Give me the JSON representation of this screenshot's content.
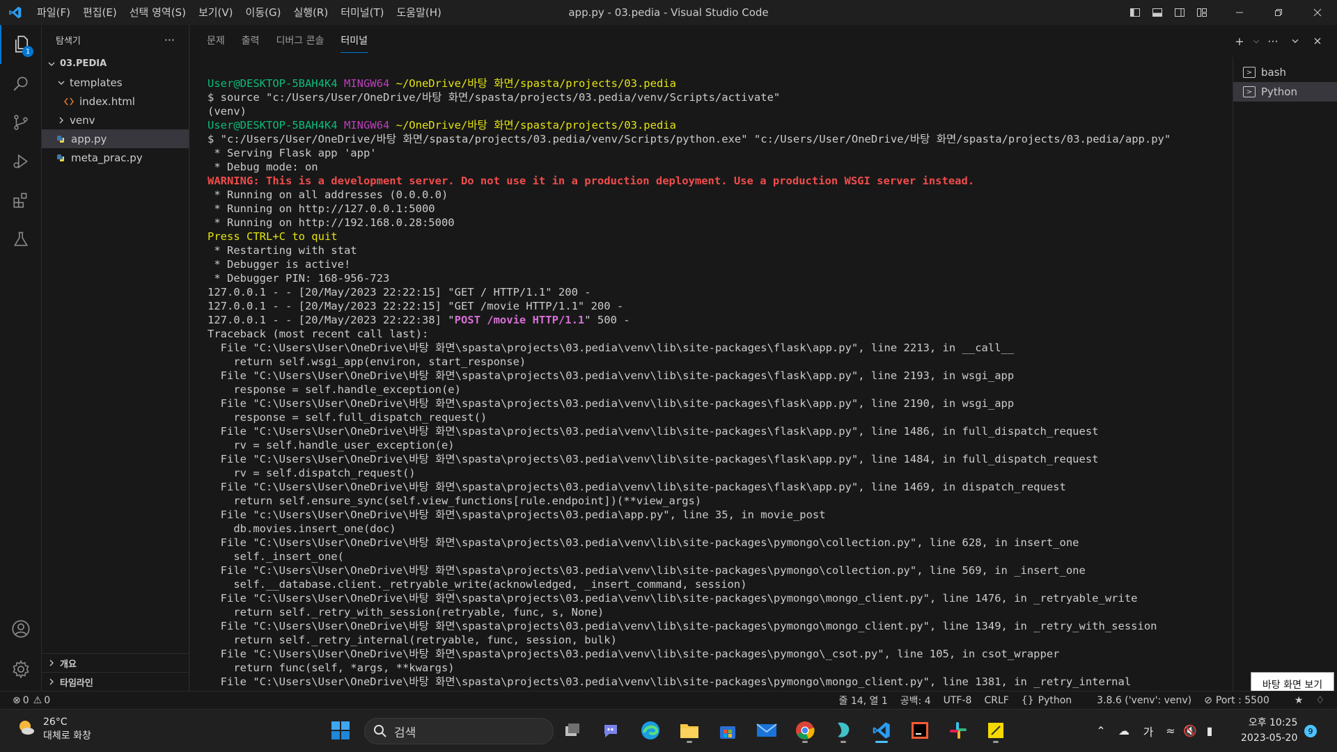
{
  "window": {
    "title": "app.py - 03.pedia - Visual Studio Code",
    "menu": [
      "파일(F)",
      "편집(E)",
      "선택 영역(S)",
      "보기(V)",
      "이동(G)",
      "실행(R)",
      "터미널(T)",
      "도움말(H)"
    ]
  },
  "activity": {
    "explorer_badge": "1"
  },
  "sidebar": {
    "title": "탐색기",
    "more": "···",
    "root": "03.PEDIA",
    "items": [
      {
        "label": "templates",
        "kind": "folder-open"
      },
      {
        "label": "index.html",
        "kind": "html"
      },
      {
        "label": "venv",
        "kind": "folder"
      },
      {
        "label": "app.py",
        "kind": "python"
      },
      {
        "label": "meta_prac.py",
        "kind": "python"
      }
    ],
    "outline": "개요",
    "timeline": "타임라인"
  },
  "panel": {
    "tabs": [
      "문제",
      "출력",
      "디버그 콘솔",
      "터미널"
    ],
    "active_tab": "터미널"
  },
  "terminal": {
    "lines": [
      [
        {
          "t": "User@DESKTOP-5BAH4K4 ",
          "c": "green"
        },
        {
          "t": "MINGW64 ",
          "c": "mag"
        },
        {
          "t": "~/OneDrive/바탕 화면/spasta/projects/03.pedia",
          "c": "yel"
        }
      ],
      [
        {
          "t": "$ source \"c:/Users/User/OneDrive/바탕 화면/spasta/projects/03.pedia/venv/Scripts/activate\"",
          "c": ""
        }
      ],
      [
        {
          "t": "(venv)",
          "c": ""
        }
      ],
      [
        {
          "t": "User@DESKTOP-5BAH4K4 ",
          "c": "green"
        },
        {
          "t": "MINGW64 ",
          "c": "mag"
        },
        {
          "t": "~/OneDrive/바탕 화면/spasta/projects/03.pedia",
          "c": "yel"
        }
      ],
      [
        {
          "t": "$ \"c:/Users/User/OneDrive/바탕 화면/spasta/projects/03.pedia/venv/Scripts/python.exe\" \"c:/Users/User/OneDrive/바탕 화면/spasta/projects/03.pedia/app.py\"",
          "c": ""
        }
      ],
      [
        {
          "t": " * Serving Flask app 'app'",
          "c": ""
        }
      ],
      [
        {
          "t": " * Debug mode: on",
          "c": ""
        }
      ],
      [
        {
          "t": "WARNING: This is a development server. Do not use it in a production deployment. Use a production WSGI server instead.",
          "c": "red"
        }
      ],
      [
        {
          "t": " * Running on all addresses (0.0.0.0)",
          "c": ""
        }
      ],
      [
        {
          "t": " * Running on http://127.0.0.1:5000",
          "c": ""
        }
      ],
      [
        {
          "t": " * Running on http://192.168.0.28:5000",
          "c": ""
        }
      ],
      [
        {
          "t": "Press CTRL+C to quit",
          "c": "yel"
        }
      ],
      [
        {
          "t": " * Restarting with stat",
          "c": ""
        }
      ],
      [
        {
          "t": " * Debugger is active!",
          "c": ""
        }
      ],
      [
        {
          "t": " * Debugger PIN: 168-956-723",
          "c": ""
        }
      ],
      [
        {
          "t": "127.0.0.1 - - [20/May/2023 22:22:15] \"GET / HTTP/1.1\" 200 -",
          "c": ""
        }
      ],
      [
        {
          "t": "127.0.0.1 - - [20/May/2023 22:22:15] \"GET /movie HTTP/1.1\" 200 -",
          "c": ""
        }
      ],
      [
        {
          "t": "127.0.0.1 - - [20/May/2023 22:22:38] \"",
          "c": ""
        },
        {
          "t": "POST /movie HTTP/1.1",
          "c": "pink"
        },
        {
          "t": "\" 500 -",
          "c": ""
        }
      ],
      [
        {
          "t": "Traceback (most recent call last):",
          "c": ""
        }
      ],
      [
        {
          "t": "  File \"C:\\Users\\User\\OneDrive\\바탕 화면\\spasta\\projects\\03.pedia\\venv\\lib\\site-packages\\flask\\app.py\", line 2213, in __call__",
          "c": ""
        }
      ],
      [
        {
          "t": "    return self.wsgi_app(environ, start_response)",
          "c": ""
        }
      ],
      [
        {
          "t": "  File \"C:\\Users\\User\\OneDrive\\바탕 화면\\spasta\\projects\\03.pedia\\venv\\lib\\site-packages\\flask\\app.py\", line 2193, in wsgi_app",
          "c": ""
        }
      ],
      [
        {
          "t": "    response = self.handle_exception(e)",
          "c": ""
        }
      ],
      [
        {
          "t": "  File \"C:\\Users\\User\\OneDrive\\바탕 화면\\spasta\\projects\\03.pedia\\venv\\lib\\site-packages\\flask\\app.py\", line 2190, in wsgi_app",
          "c": ""
        }
      ],
      [
        {
          "t": "    response = self.full_dispatch_request()",
          "c": ""
        }
      ],
      [
        {
          "t": "  File \"C:\\Users\\User\\OneDrive\\바탕 화면\\spasta\\projects\\03.pedia\\venv\\lib\\site-packages\\flask\\app.py\", line 1486, in full_dispatch_request",
          "c": ""
        }
      ],
      [
        {
          "t": "    rv = self.handle_user_exception(e)",
          "c": ""
        }
      ],
      [
        {
          "t": "  File \"C:\\Users\\User\\OneDrive\\바탕 화면\\spasta\\projects\\03.pedia\\venv\\lib\\site-packages\\flask\\app.py\", line 1484, in full_dispatch_request",
          "c": ""
        }
      ],
      [
        {
          "t": "    rv = self.dispatch_request()",
          "c": ""
        }
      ],
      [
        {
          "t": "  File \"C:\\Users\\User\\OneDrive\\바탕 화면\\spasta\\projects\\03.pedia\\venv\\lib\\site-packages\\flask\\app.py\", line 1469, in dispatch_request",
          "c": ""
        }
      ],
      [
        {
          "t": "    return self.ensure_sync(self.view_functions[rule.endpoint])(**view_args)",
          "c": ""
        }
      ],
      [
        {
          "t": "  File \"c:\\Users\\User\\OneDrive\\바탕 화면\\spasta\\projects\\03.pedia\\app.py\", line 35, in movie_post",
          "c": ""
        }
      ],
      [
        {
          "t": "    db.movies.insert_one(doc)",
          "c": ""
        }
      ],
      [
        {
          "t": "  File \"C:\\Users\\User\\OneDrive\\바탕 화면\\spasta\\projects\\03.pedia\\venv\\lib\\site-packages\\pymongo\\collection.py\", line 628, in insert_one",
          "c": ""
        }
      ],
      [
        {
          "t": "    self._insert_one(",
          "c": ""
        }
      ],
      [
        {
          "t": "  File \"C:\\Users\\User\\OneDrive\\바탕 화면\\spasta\\projects\\03.pedia\\venv\\lib\\site-packages\\pymongo\\collection.py\", line 569, in _insert_one",
          "c": ""
        }
      ],
      [
        {
          "t": "    self.__database.client._retryable_write(acknowledged, _insert_command, session)",
          "c": ""
        }
      ],
      [
        {
          "t": "  File \"C:\\Users\\User\\OneDrive\\바탕 화면\\spasta\\projects\\03.pedia\\venv\\lib\\site-packages\\pymongo\\mongo_client.py\", line 1476, in _retryable_write",
          "c": ""
        }
      ],
      [
        {
          "t": "    return self._retry_with_session(retryable, func, s, None)",
          "c": ""
        }
      ],
      [
        {
          "t": "  File \"C:\\Users\\User\\OneDrive\\바탕 화면\\spasta\\projects\\03.pedia\\venv\\lib\\site-packages\\pymongo\\mongo_client.py\", line 1349, in _retry_with_session",
          "c": ""
        }
      ],
      [
        {
          "t": "    return self._retry_internal(retryable, func, session, bulk)",
          "c": ""
        }
      ],
      [
        {
          "t": "  File \"C:\\Users\\User\\OneDrive\\바탕 화면\\spasta\\projects\\03.pedia\\venv\\lib\\site-packages\\pymongo\\_csot.py\", line 105, in csot_wrapper",
          "c": ""
        }
      ],
      [
        {
          "t": "    return func(self, *args, **kwargs)",
          "c": ""
        }
      ],
      [
        {
          "t": "  File \"C:\\Users\\User\\OneDrive\\바탕 화면\\spasta\\projects\\03.pedia\\venv\\lib\\site-packages\\pymongo\\mongo_client.py\", line 1381, in _retry_internal",
          "c": ""
        }
      ]
    ],
    "sessions": [
      "bash",
      "Python"
    ],
    "active_session": "Python"
  },
  "tooltip": "바탕 화면 보기",
  "statusbar": {
    "errors": "0",
    "warnings": "0",
    "position": "줄 14, 열 1",
    "spaces": "공백: 4",
    "encoding": "UTF-8",
    "eol": "CRLF",
    "language": "Python",
    "interpreter": "3.8.6 ('venv': venv)",
    "port": "Port : 5500"
  },
  "taskbar": {
    "weather_temp": "26°C",
    "weather_desc": "대체로 화창",
    "search_placeholder": "검색",
    "ime": "가",
    "time": "오후 10:25",
    "date": "2023-05-20",
    "notifications": "9"
  },
  "colors": {
    "accent": "#0078d4",
    "prompt_user": "#0dbc79",
    "prompt_host": "#bc3fbc",
    "prompt_path": "#e5e510",
    "warning": "#f14c4c",
    "status_500": "#d670d6"
  }
}
